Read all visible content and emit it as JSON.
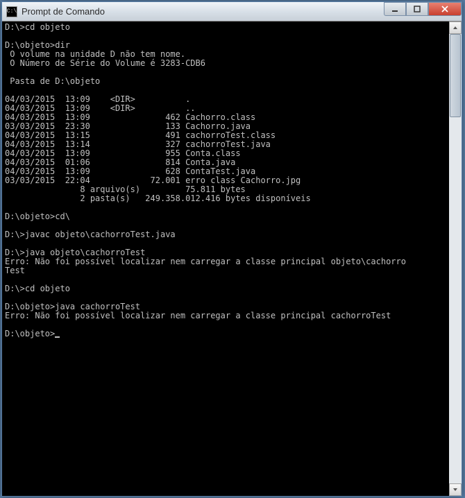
{
  "titlebar": {
    "icon_label": "C:\\",
    "title": "Prompt de Comando"
  },
  "terminal": {
    "lines": [
      "D:\\>cd objeto",
      "",
      "D:\\objeto>dir",
      " O volume na unidade D não tem nome.",
      " O Número de Série do Volume é 3283-CDB6",
      "",
      " Pasta de D:\\objeto",
      "",
      "04/03/2015  13:09    <DIR>          .",
      "04/03/2015  13:09    <DIR>          ..",
      "04/03/2015  13:09               462 Cachorro.class",
      "03/03/2015  23:30               133 Cachorro.java",
      "04/03/2015  13:15               491 cachorroTest.class",
      "04/03/2015  13:14               327 cachorroTest.java",
      "04/03/2015  13:09               955 Conta.class",
      "04/03/2015  01:06               814 Conta.java",
      "04/03/2015  13:09               628 ContaTest.java",
      "03/03/2015  22:04            72.001 erro class Cachorro.jpg",
      "               8 arquivo(s)         75.811 bytes",
      "               2 pasta(s)   249.358.012.416 bytes disponíveis",
      "",
      "D:\\objeto>cd\\",
      "",
      "D:\\>javac objeto\\cachorroTest.java",
      "",
      "D:\\>java objeto\\cachorroTest",
      "Erro: Não foi possível localizar nem carregar a classe principal objeto\\cachorro",
      "Test",
      "",
      "D:\\>cd objeto",
      "",
      "D:\\objeto>java cachorroTest",
      "Erro: Não foi possível localizar nem carregar a classe principal cachorroTest",
      "",
      "D:\\objeto>"
    ]
  }
}
